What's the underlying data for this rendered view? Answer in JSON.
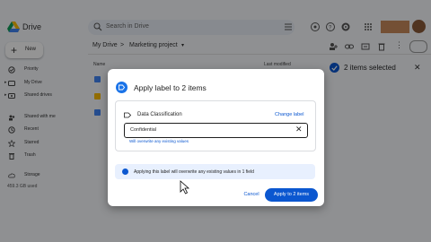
{
  "app": {
    "name": "Drive"
  },
  "search": {
    "placeholder": "Search in Drive"
  },
  "sidebar": {
    "new_label": "New",
    "items": [
      {
        "label": "Priority",
        "icon": "priority-icon"
      },
      {
        "label": "My Drive",
        "icon": "my-drive-icon"
      },
      {
        "label": "Shared drives",
        "icon": "shared-drives-icon"
      },
      {
        "label": "Shared with me",
        "icon": "shared-with-me-icon"
      },
      {
        "label": "Recent",
        "icon": "recent-icon"
      },
      {
        "label": "Starred",
        "icon": "starred-icon"
      },
      {
        "label": "Trash",
        "icon": "trash-icon"
      },
      {
        "label": "Storage",
        "icon": "cloud-icon"
      }
    ],
    "storage_text": "459.3 GB used"
  },
  "breadcrumb": {
    "root": "My Drive",
    "sep": ">",
    "current": "Marketing project"
  },
  "list_header": {
    "name": "Name",
    "modified": "Last modified"
  },
  "selection": {
    "text": "2 items selected"
  },
  "dialog": {
    "title": "Apply label to 2 items",
    "field_name": "Data Classification",
    "change_label": "Change label",
    "input_value": "Confidential",
    "helper_text": "Will overwrite any existing values",
    "info_text": "Applying this label will overwrite any existing values in 1 field",
    "cancel_label": "Cancel",
    "apply_label": "Apply to 2 items"
  },
  "colors": {
    "accent": "#0b57d0",
    "info_bg": "#e8f0fe"
  }
}
